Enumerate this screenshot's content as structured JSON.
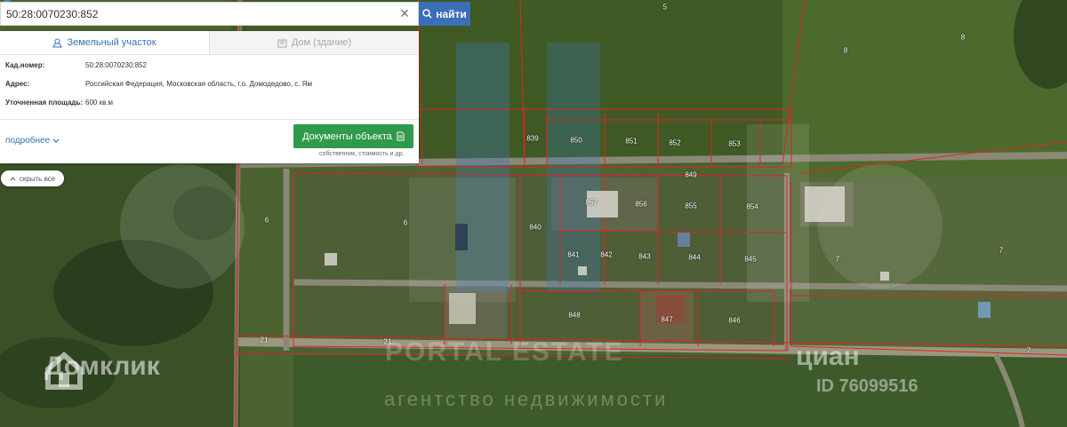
{
  "search": {
    "value": "50:28:0070230:852",
    "clear_icon": "close-icon",
    "button_label": "найти",
    "button_icon": "search-icon"
  },
  "info_panel": {
    "tabs": [
      {
        "label": "Земельный участок",
        "icon": "land-plot-icon",
        "active": true
      },
      {
        "label": "Дом (здание)",
        "icon": "building-icon",
        "active": false
      }
    ],
    "properties": [
      {
        "key": "Кад.номер:",
        "value": "50:28:0070230:852"
      },
      {
        "key": "Адрес:",
        "value": "Российская Федерация, Московская область, г.о. Домодедово, с. Ям"
      },
      {
        "key": "Уточненная площадь:",
        "value": "600 кв.м"
      }
    ],
    "more_link": "подробнее",
    "docs_button": "Документы объекта",
    "docs_hint": "собственник, стоимость и др."
  },
  "hide_all_button": "скрыть все",
  "parcel_labels": [
    "5",
    "8",
    "8",
    "839",
    "850",
    "851",
    "852",
    "853",
    "849",
    "857",
    "856",
    "855",
    "854",
    "6",
    "6",
    "840",
    "841",
    "842",
    "843",
    "844",
    "845",
    "7",
    "7",
    "848",
    "847",
    "846",
    "21",
    "21",
    "7"
  ],
  "watermarks": {
    "domclick": "Домклик",
    "portal": "PORTAL ESTATE",
    "agency": "агентство недвижимости",
    "cian": "циан",
    "cian_id": "ID 76099516"
  },
  "colors": {
    "accent_blue": "#3a6fb8",
    "docs_green": "#2f9a4c",
    "parcel_border": "#e02424",
    "marker": "#3f8fe0"
  }
}
